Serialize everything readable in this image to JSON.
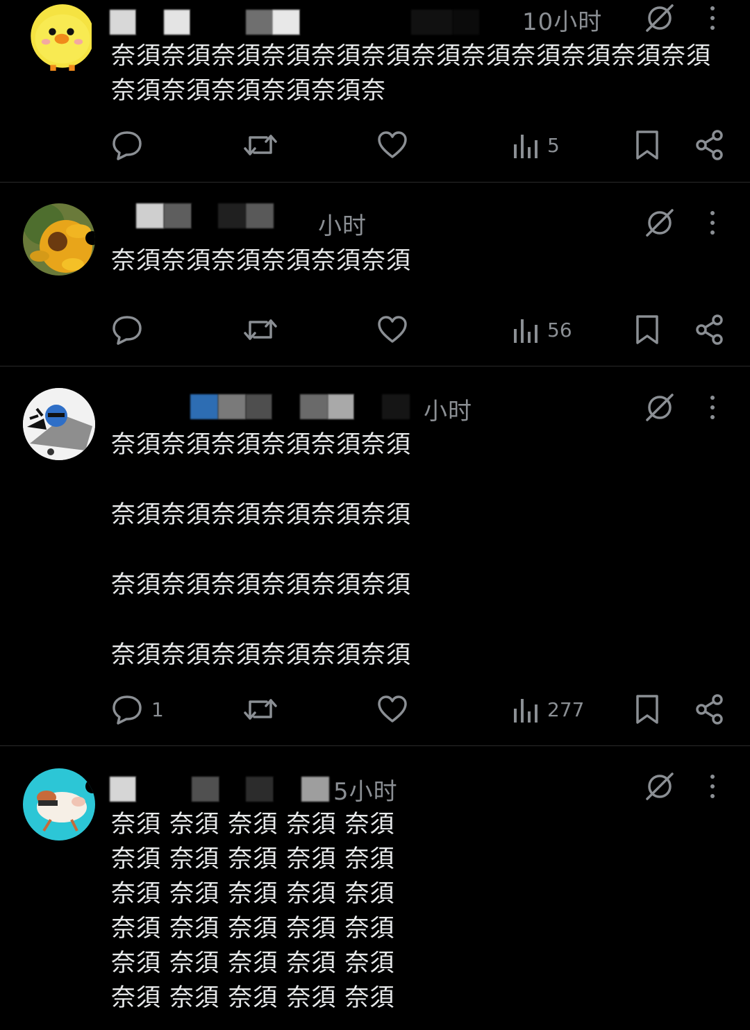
{
  "posts": [
    {
      "time": "10小时",
      "text": "奈須奈須奈須奈須奈須奈須奈須奈須奈須奈須奈須奈須奈須奈須奈須奈須奈須奈",
      "reply_count": "",
      "views": "5"
    },
    {
      "time": "小时",
      "text": "奈須奈須奈須奈須奈須奈須",
      "reply_count": "",
      "views": "56"
    },
    {
      "time": "小时",
      "lines": [
        "奈須奈須奈須奈須奈須奈須",
        "奈須奈須奈須奈須奈須奈須",
        "奈須奈須奈須奈須奈須奈須",
        "奈須奈須奈須奈須奈須奈須"
      ],
      "reply_count": "1",
      "views": "277"
    },
    {
      "time": "5小时",
      "lines": [
        "奈須 奈須 奈須 奈須 奈須",
        "奈須 奈須 奈須 奈須 奈須",
        "奈須 奈須 奈須 奈須 奈須",
        "奈須 奈須 奈須 奈須 奈須",
        "奈須 奈須 奈須 奈須 奈須",
        "奈須 奈須 奈須 奈須 奈須"
      ]
    }
  ],
  "icons": {
    "reply": "reply-icon",
    "repost": "repost-icon",
    "like": "heart-icon",
    "views": "views-icon",
    "bookmark": "bookmark-icon",
    "share": "share-icon",
    "grok": "grok-icon",
    "more": "more-icon"
  },
  "colors": {
    "background": "#000000",
    "text": "#e7e9ea",
    "muted": "#8b8f94",
    "divider": "#2a2a2a"
  }
}
